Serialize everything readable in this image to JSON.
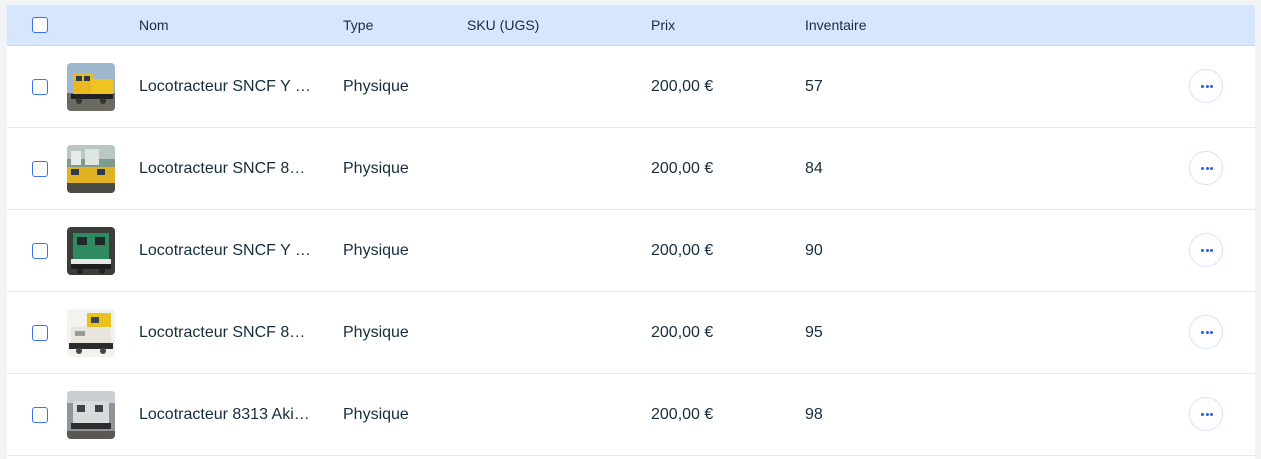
{
  "header": {
    "name": "Nom",
    "type": "Type",
    "sku": "SKU (UGS)",
    "price": "Prix",
    "inventory": "Inventaire"
  },
  "rows": [
    {
      "name": "Locotracteur SNCF Y …",
      "type": "Physique",
      "sku": "",
      "price": "200,00 €",
      "inventory": "57"
    },
    {
      "name": "Locotracteur SNCF 8…",
      "type": "Physique",
      "sku": "",
      "price": "200,00 €",
      "inventory": "84"
    },
    {
      "name": "Locotracteur SNCF Y …",
      "type": "Physique",
      "sku": "",
      "price": "200,00 €",
      "inventory": "90"
    },
    {
      "name": "Locotracteur SNCF 8…",
      "type": "Physique",
      "sku": "",
      "price": "200,00 €",
      "inventory": "95"
    },
    {
      "name": "Locotracteur 8313 Aki…",
      "type": "Physique",
      "sku": "",
      "price": "200,00 €",
      "inventory": "98"
    }
  ],
  "colors": {
    "header_bg": "#d6e6fe",
    "accent": "#3b6ff5",
    "text": "#162d3d"
  },
  "icons": {
    "more": "more-horizontal-icon",
    "thumbnails": [
      "locomotive-yellow-thumbnail",
      "locomotive-yellow-depot-thumbnail",
      "locomotive-green-thumbnail",
      "locomotive-yellow-white-thumbnail",
      "locomotive-grey-thumbnail"
    ]
  }
}
